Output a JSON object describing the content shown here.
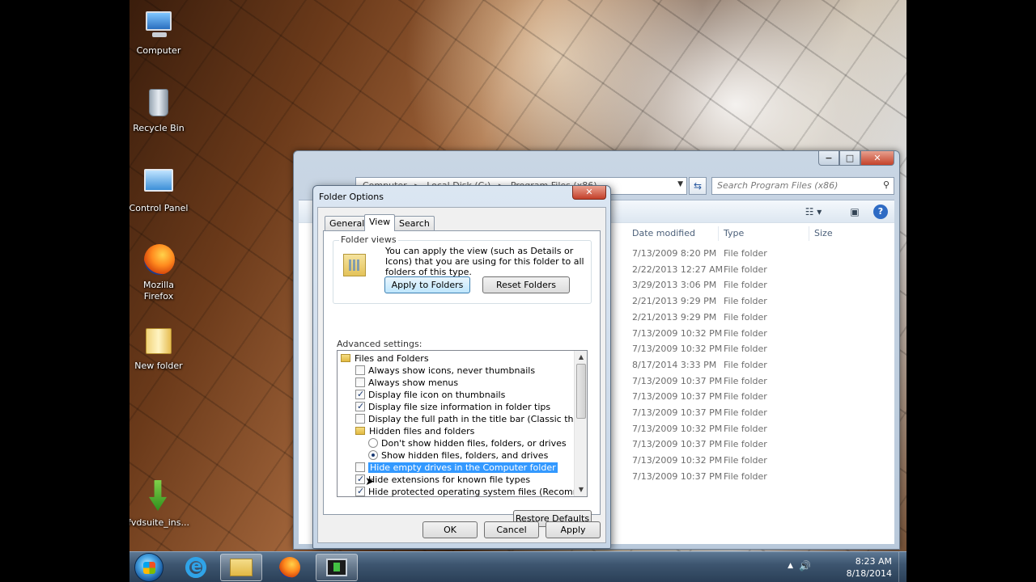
{
  "desktop": {
    "icons": [
      {
        "label": "Computer"
      },
      {
        "label": "Recycle Bin"
      },
      {
        "label": "Control Panel"
      },
      {
        "label": "Mozilla Firefox"
      },
      {
        "label": "New folder"
      },
      {
        "label": "fvdsuite_ins..."
      }
    ]
  },
  "explorer": {
    "address": {
      "crumbs": [
        "Computer",
        "Local Disk (C:)",
        "Program Files (x86)"
      ]
    },
    "search_placeholder": "Search Program Files (x86)",
    "window_controls": {
      "minimize": "−",
      "maximize": "□",
      "close": "✕"
    },
    "columns": {
      "date": "Date modified",
      "type": "Type",
      "size": "Size"
    },
    "rows": [
      {
        "date": "7/13/2009 8:20 PM",
        "type": "File folder"
      },
      {
        "date": "2/22/2013 12:27 AM",
        "type": "File folder"
      },
      {
        "date": "3/29/2013 3:06 PM",
        "type": "File folder"
      },
      {
        "date": "2/21/2013 9:29 PM",
        "type": "File folder"
      },
      {
        "date": "2/21/2013 9:29 PM",
        "type": "File folder"
      },
      {
        "date": "7/13/2009 10:32 PM",
        "type": "File folder"
      },
      {
        "date": "7/13/2009 10:32 PM",
        "type": "File folder"
      },
      {
        "date": "8/17/2014 3:33 PM",
        "type": "File folder"
      },
      {
        "date": "7/13/2009 10:37 PM",
        "type": "File folder"
      },
      {
        "date": "7/13/2009 10:37 PM",
        "type": "File folder"
      },
      {
        "date": "7/13/2009 10:37 PM",
        "type": "File folder"
      },
      {
        "date": "7/13/2009 10:32 PM",
        "type": "File folder"
      },
      {
        "date": "7/13/2009 10:37 PM",
        "type": "File folder"
      },
      {
        "date": "7/13/2009 10:32 PM",
        "type": "File folder"
      },
      {
        "date": "7/13/2009 10:37 PM",
        "type": "File folder"
      }
    ]
  },
  "dialog": {
    "title": "Folder Options",
    "close": "✕",
    "tabs": [
      "General",
      "View",
      "Search"
    ],
    "active_tab": "View",
    "folder_views": {
      "label": "Folder views",
      "description": "You can apply the view (such as Details or Icons) that you are using for this folder to all folders of this type.",
      "apply_button": "Apply to Folders",
      "reset_button": "Reset Folders"
    },
    "advanced_label": "Advanced settings:",
    "tree": [
      {
        "kind": "folder",
        "label": "Files and Folders"
      },
      {
        "kind": "checkbox",
        "checked": false,
        "label": "Always show icons, never thumbnails"
      },
      {
        "kind": "checkbox",
        "checked": false,
        "label": "Always show menus"
      },
      {
        "kind": "checkbox",
        "checked": true,
        "label": "Display file icon on thumbnails"
      },
      {
        "kind": "checkbox",
        "checked": true,
        "label": "Display file size information in folder tips"
      },
      {
        "kind": "checkbox",
        "checked": false,
        "label": "Display the full path in the title bar (Classic theme only)"
      },
      {
        "kind": "folder",
        "label": "Hidden files and folders"
      },
      {
        "kind": "radio",
        "checked": false,
        "label": "Don't show hidden files, folders, or drives"
      },
      {
        "kind": "radio",
        "checked": true,
        "label": "Show hidden files, folders, and drives"
      },
      {
        "kind": "checkbox",
        "checked": false,
        "label": "Hide empty drives in the Computer folder",
        "selected": true
      },
      {
        "kind": "checkbox",
        "checked": true,
        "label": "Hide extensions for known file types"
      },
      {
        "kind": "checkbox",
        "checked": true,
        "label": "Hide protected operating system files (Recommended)"
      }
    ],
    "restore_button": "Restore Defaults",
    "ok_button": "OK",
    "cancel_button": "Cancel",
    "apply_button": "Apply"
  },
  "taskbar": {
    "clock_time": "8:23 AM",
    "clock_date": "8/18/2014",
    "tray_arrow": "▲",
    "volume_icon": "🔊"
  }
}
